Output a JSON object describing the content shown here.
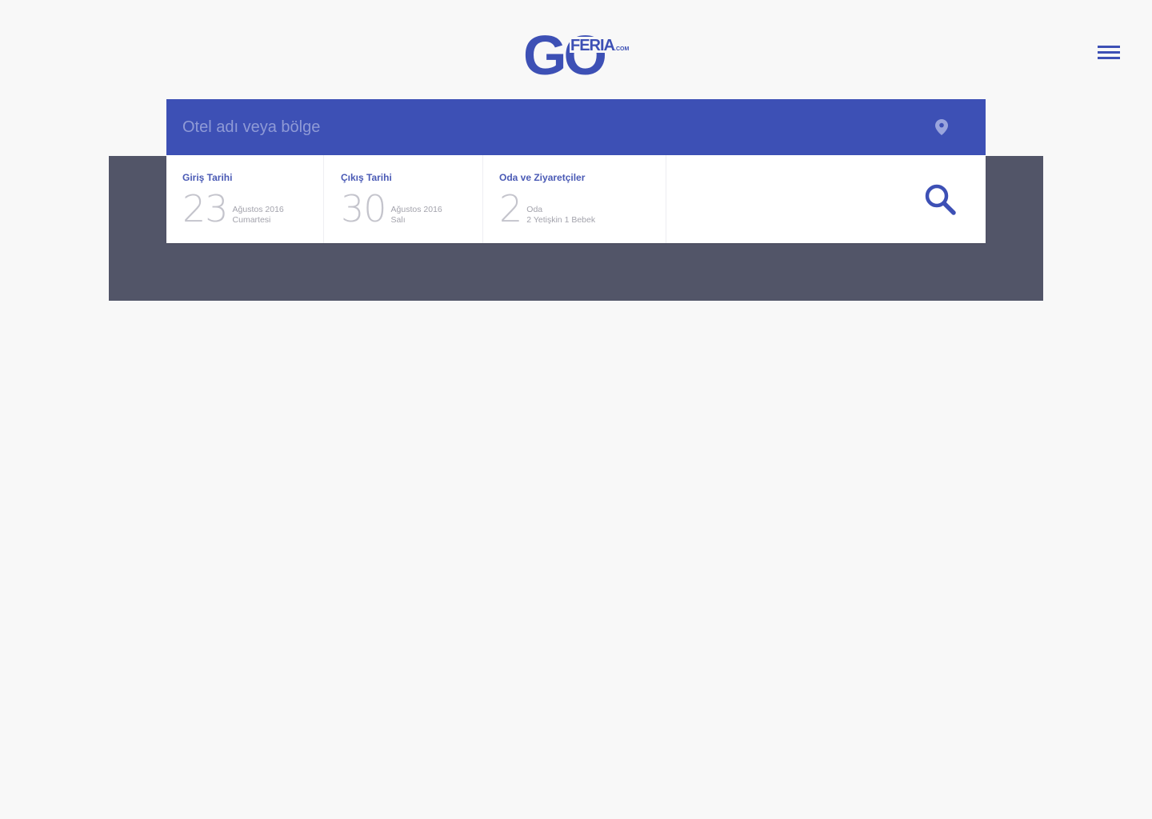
{
  "header": {
    "logo": {
      "main_text": "GO",
      "brand_text": "FERIA",
      "suffix_text": ".COM",
      "icon": "goferia-logo"
    },
    "menu_icon": "hamburger-menu-icon"
  },
  "search": {
    "placeholder": "Otel adı veya bölge",
    "value": "",
    "location_icon": "location-pin-icon"
  },
  "booking": {
    "checkin": {
      "label": "Giriş Tarihi",
      "day": "23",
      "month_year": "Ağustos 2016",
      "weekday": "Cumartesi"
    },
    "checkout": {
      "label": "Çıkış Tarihi",
      "day": "30",
      "month_year": "Ağustos 2016",
      "weekday": "Salı"
    },
    "rooms": {
      "label": "Oda ve Ziyaretçiler",
      "count": "2",
      "unit": "Oda",
      "guests": "2 Yetişkin 1 Bebek"
    },
    "search_icon": "magnifier-search-icon"
  },
  "colors": {
    "brand": "#3d50b5",
    "hero_band": "#525568",
    "page_background": "#f8f8f8",
    "placeholder": "#8f9ad6",
    "number_text": "#c4c4cc"
  }
}
